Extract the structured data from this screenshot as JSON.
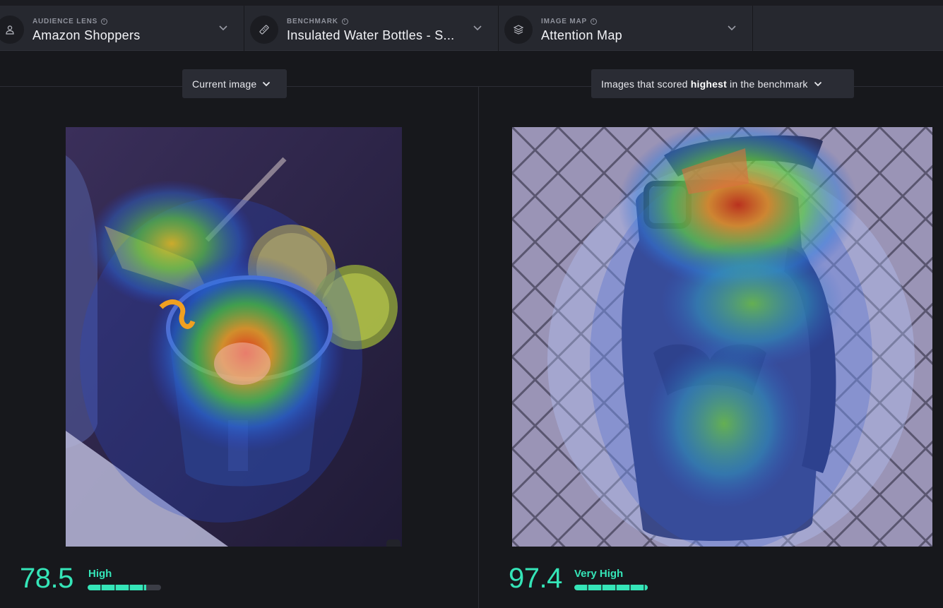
{
  "selectors": [
    {
      "label": "AUDIENCE LENS",
      "value": "Amazon Shoppers",
      "icon": "person-icon"
    },
    {
      "label": "BENCHMARK",
      "value": "Insulated Water Bottles - S...",
      "icon": "ruler-icon"
    },
    {
      "label": "IMAGE MAP",
      "value": "Attention Map",
      "icon": "layers-icon"
    }
  ],
  "left_panel": {
    "dropdown": "Current image",
    "score": "78.5",
    "rating": "High",
    "rating_level": 0.8
  },
  "right_panel": {
    "dropdown_pre": "Images that scored ",
    "dropdown_bold": "highest",
    "dropdown_post": " in the benchmark",
    "score": "97.4",
    "rating": "Very High",
    "rating_level": 1.0
  },
  "colors": {
    "accent": "#35e5b8",
    "background": "#17181c",
    "selector_bar": "#26282f"
  }
}
